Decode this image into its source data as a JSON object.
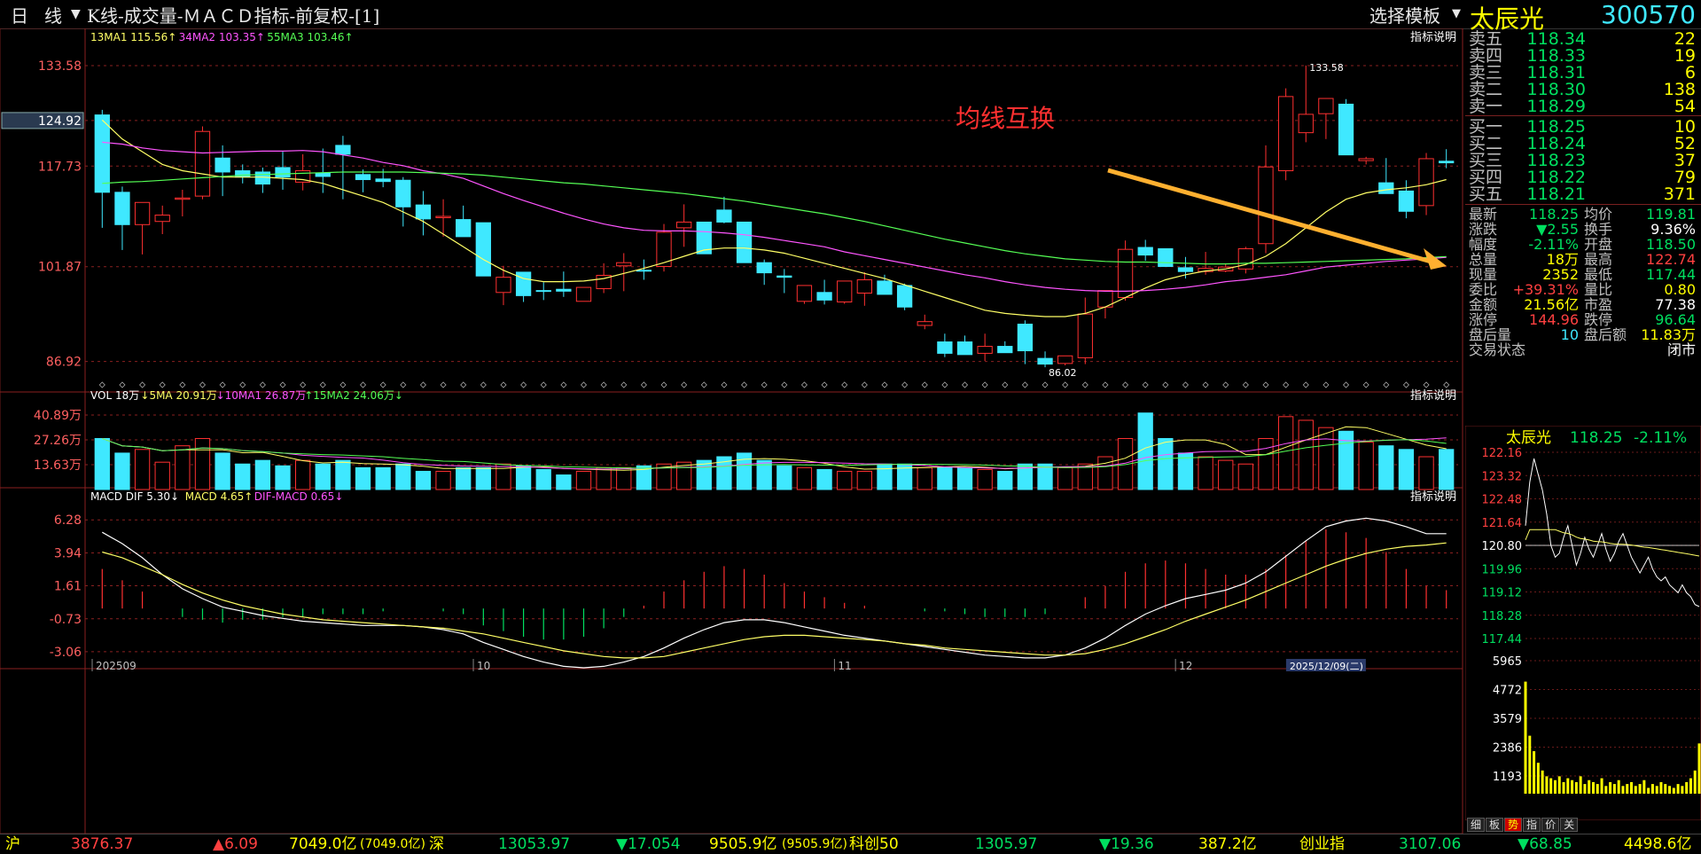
{
  "header": {
    "period_day": "日",
    "period_line": "线",
    "title": "K线-成交量-ＭＡＣＤ指标-前复权-[1]",
    "select_template": "选择模板",
    "stock_name": "太辰光",
    "stock_code": "300570"
  },
  "annotation": {
    "text": "均线互换"
  },
  "kline": {
    "ma_legend": [
      {
        "text": "13MA1 115.56↑",
        "color": "#ffff66"
      },
      {
        "text": "34MA2 103.35↑",
        "color": "#ff55ff"
      },
      {
        "text": "55MA3 103.46↑",
        "color": "#55ff55"
      }
    ],
    "help": "指标说明",
    "y_labels": [
      "133.58",
      "124.92",
      "117.73",
      "101.87",
      "86.92"
    ],
    "high_label": "133.58",
    "low_label": "86.02",
    "x_labels": [
      "202509",
      "10",
      "11",
      "12"
    ],
    "cursor_date": "2025/12/09(二)"
  },
  "volume": {
    "legend": [
      {
        "text": "VOL 18万",
        "color": "#ffffff"
      },
      {
        "text": "↓5MA 20.91万",
        "color": "#ffff66"
      },
      {
        "text": "↓10MA1 26.87万",
        "color": "#ff55ff"
      },
      {
        "text": "↑15MA2 24.06万↓",
        "color": "#55ff55"
      }
    ],
    "help": "指标说明",
    "y_labels": [
      "40.89万",
      "27.26万",
      "13.63万"
    ]
  },
  "macd": {
    "legend": [
      {
        "text": "MACD DIF 5.30↓",
        "color": "#ffffff"
      },
      {
        "text": "MACD 4.65↑",
        "color": "#ffff66"
      },
      {
        "text": "DIF-MACD 0.65↓",
        "color": "#ff55ff"
      }
    ],
    "help": "指标说明",
    "y_labels": [
      "6.28",
      "3.94",
      "1.61",
      "-0.73",
      "-3.06"
    ]
  },
  "quote": {
    "asks": [
      {
        "label": "卖五",
        "price": "118.34",
        "vol": "22"
      },
      {
        "label": "卖四",
        "price": "118.33",
        "vol": "19"
      },
      {
        "label": "卖三",
        "price": "118.31",
        "vol": "6"
      },
      {
        "label": "卖二",
        "price": "118.30",
        "vol": "138"
      },
      {
        "label": "卖一",
        "price": "118.29",
        "vol": "54"
      }
    ],
    "bids": [
      {
        "label": "买一",
        "price": "118.25",
        "vol": "10"
      },
      {
        "label": "买二",
        "price": "118.24",
        "vol": "52"
      },
      {
        "label": "买三",
        "price": "118.23",
        "vol": "37"
      },
      {
        "label": "买四",
        "price": "118.22",
        "vol": "79"
      },
      {
        "label": "买五",
        "price": "118.21",
        "vol": "371"
      }
    ],
    "stats": [
      {
        "l1": "最新",
        "v1": "118.25",
        "c1": "#00e060",
        "l2": "均价",
        "v2": "119.81",
        "c2": "#00e060"
      },
      {
        "l1": "涨跌",
        "v1": "▼2.55",
        "c1": "#00e060",
        "l2": "换手",
        "v2": "9.36%",
        "c2": "#ffffff"
      },
      {
        "l1": "幅度",
        "v1": "-2.11%",
        "c1": "#00e060",
        "l2": "开盘",
        "v2": "118.50",
        "c2": "#00e060"
      },
      {
        "l1": "总量",
        "v1": "18万",
        "c1": "#ffff00",
        "l2": "最高",
        "v2": "122.74",
        "c2": "#ff4040"
      },
      {
        "l1": "现量",
        "v1": "2352",
        "c1": "#ffff00",
        "l2": "最低",
        "v2": "117.44",
        "c2": "#00e060"
      },
      {
        "l1": "委比",
        "v1": "+39.31%",
        "c1": "#ff4040",
        "l2": "量比",
        "v2": "0.80",
        "c2": "#ffff00"
      },
      {
        "l1": "金额",
        "v1": "21.56亿",
        "c1": "#ffff00",
        "l2": "市盈",
        "v2": "77.38",
        "c2": "#ffffff"
      },
      {
        "l1": "涨停",
        "v1": "144.96",
        "c1": "#ff4040",
        "l2": "跌停",
        "v2": "96.64",
        "c2": "#00e060"
      },
      {
        "l1": "盘后量",
        "v1": "10",
        "c1": "#3fe8ff",
        "l2": "盘后额",
        "v2": "11.83万",
        "c2": "#ffff00"
      },
      {
        "l1": "交易状态",
        "v1": "",
        "c1": "#ffffff",
        "l2": "",
        "v2": "闭市",
        "c2": "#ffffff"
      }
    ]
  },
  "mini": {
    "name": "太辰光",
    "price": "118.25",
    "change": "-2.11%",
    "price_labels": [
      "122.16",
      "123.32",
      "122.48",
      "121.64",
      "120.80",
      "119.96",
      "119.12",
      "118.28",
      "117.44"
    ],
    "vol_labels": [
      "5965",
      "4772",
      "3579",
      "2386",
      "1193"
    ],
    "tabs": [
      "细",
      "板",
      "势",
      "指",
      "价",
      "关"
    ],
    "active_tab": "势"
  },
  "status_bar": {
    "sh_label": "沪",
    "sh_index": "3876.37",
    "sh_change": "▲6.09",
    "sh_amount": "7049.0亿",
    "sh_amount2": "(7049.0亿)",
    "sz_label": "深",
    "sz_index": "13053.97",
    "sz_change": "▼17.054",
    "sz_amount": "9505.9亿",
    "sz_amount2": "(9505.9亿)",
    "kc_label": "科创50",
    "kc_index": "1305.97",
    "kc_change": "▼19.36",
    "kc_amount": "387.2亿",
    "cy_label": "创业指",
    "cy_index": "3107.06",
    "cy_change": "▼68.85",
    "cy_amount": "4498.6亿"
  }
}
